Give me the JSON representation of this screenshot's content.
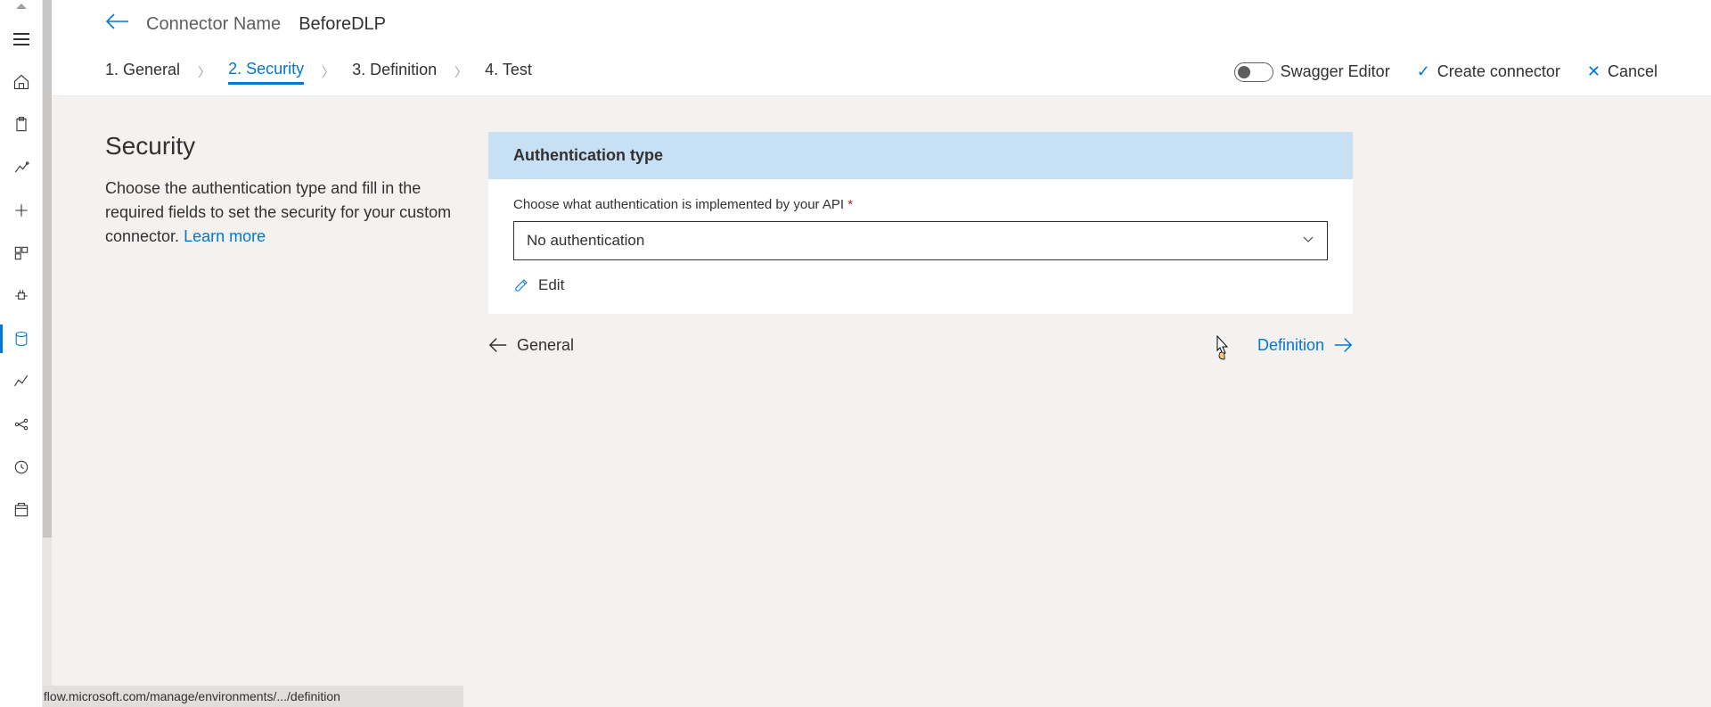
{
  "header": {
    "label": "Connector Name",
    "name": "BeforeDLP"
  },
  "tabs": {
    "t1": "1. General",
    "t2": "2. Security",
    "t3": "3. Definition",
    "t4": "4. Test"
  },
  "actions": {
    "swagger": "Swagger Editor",
    "create": "Create connector",
    "cancel": "Cancel"
  },
  "leftPane": {
    "title": "Security",
    "desc": "Choose the authentication type and fill in the required fields to set the security for your custom connector.",
    "learn": "Learn more"
  },
  "card": {
    "header": "Authentication type",
    "fieldLabel": "Choose what authentication is implemented by your API",
    "selectedValue": "No authentication",
    "edit": "Edit"
  },
  "navFooter": {
    "prev": "General",
    "next": "Definition"
  },
  "statusBar": "emea.flow.microsoft.com/manage/environments/.../definition",
  "iconNames": {
    "hamburger": "menu-icon",
    "home": "home-icon",
    "clipboard": "action-items-icon",
    "flows": "my-flows-icon",
    "create": "create-icon",
    "templates": "templates-icon",
    "connectors": "connectors-icon",
    "data": "data-icon",
    "monitor": "monitor-icon",
    "ai": "ai-builder-icon",
    "process": "process-advisor-icon",
    "solutions": "solutions-icon"
  }
}
